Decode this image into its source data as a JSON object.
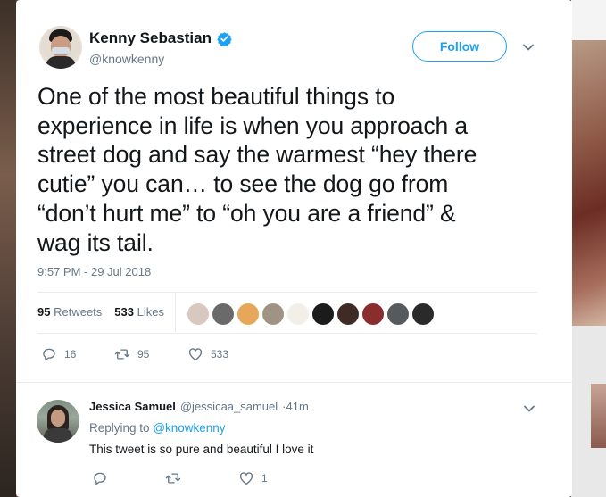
{
  "tweet": {
    "author": {
      "name": "Kenny Sebastian",
      "handle": "@knowkenny",
      "verified": true
    },
    "follow_label": "Follow",
    "text": "One of the most beautiful things to\nexperience in life is when you approach a\nstreet dog and say the warmest “hey there\ncutie” you can… to see the dog go from\n“don’t hurt me” to “oh you are a friend” &\nwag its tail.",
    "timestamp": "9:57 PM - 29 Jul 2018",
    "stats": {
      "retweets_count": "95",
      "retweets_label": "Retweets",
      "likes_count": "533",
      "likes_label": "Likes"
    },
    "liker_avatars": [
      {
        "name": "liker-avatar-1",
        "color": "#d8c8c0"
      },
      {
        "name": "liker-avatar-2",
        "color": "#6a6a6a"
      },
      {
        "name": "liker-avatar-3",
        "color": "#e7a75a"
      },
      {
        "name": "liker-avatar-4",
        "color": "#9f9484"
      },
      {
        "name": "liker-avatar-5",
        "color": "#f2efe8"
      },
      {
        "name": "liker-avatar-6",
        "color": "#1b1b1b"
      },
      {
        "name": "liker-avatar-7",
        "color": "#3d2b24"
      },
      {
        "name": "liker-avatar-8",
        "color": "#8a2d2d"
      },
      {
        "name": "liker-avatar-9",
        "color": "#555a5e"
      },
      {
        "name": "liker-avatar-10",
        "color": "#2a2a2a"
      }
    ],
    "actions": {
      "reply_count": "16",
      "retweet_count": "95",
      "like_count": "533"
    }
  },
  "reply": {
    "name": "Jessica Samuel",
    "handle": "@jessicaa_samuel",
    "time": "·41m",
    "replying_prefix": "Replying to",
    "replying_to": "@knowkenny",
    "text": "This tweet is so pure and beautiful I love it",
    "actions": {
      "reply_count": "",
      "retweet_count": "",
      "like_count": "1"
    }
  },
  "colors": {
    "accent": "#1da1f2",
    "text_primary": "#14171a",
    "text_secondary": "#657786",
    "divider": "#e6ecf0"
  },
  "icons": [
    "verified-badge-icon",
    "chevron-down-icon",
    "reply-icon",
    "retweet-icon",
    "heart-icon"
  ]
}
